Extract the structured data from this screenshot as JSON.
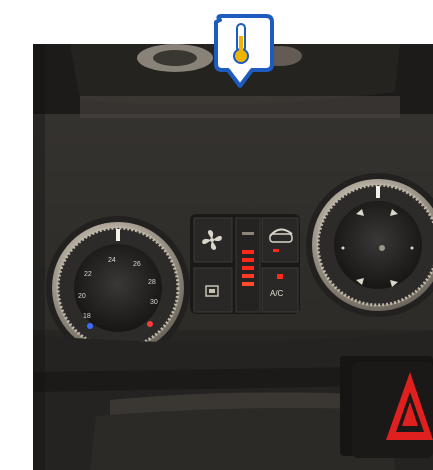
{
  "marker": {
    "icon": "thermometer-icon",
    "accent": "#f0b400",
    "stroke": "#1e5bbf"
  },
  "controls": {
    "temp_dial_numbers": [
      "18",
      "20",
      "22",
      "24",
      "26",
      "28",
      "30"
    ],
    "ac_label": "A/C",
    "fan_icon": "fan-icon",
    "recirculation_icon": "air-recirculation-icon",
    "hazard_icon": "hazard-warning-icon"
  },
  "colors": {
    "dashboard": "#2f2d2a",
    "trim": "#1d1c1a",
    "indicator_red": "#ff2a1c",
    "hazard_red": "#e01f1f"
  }
}
